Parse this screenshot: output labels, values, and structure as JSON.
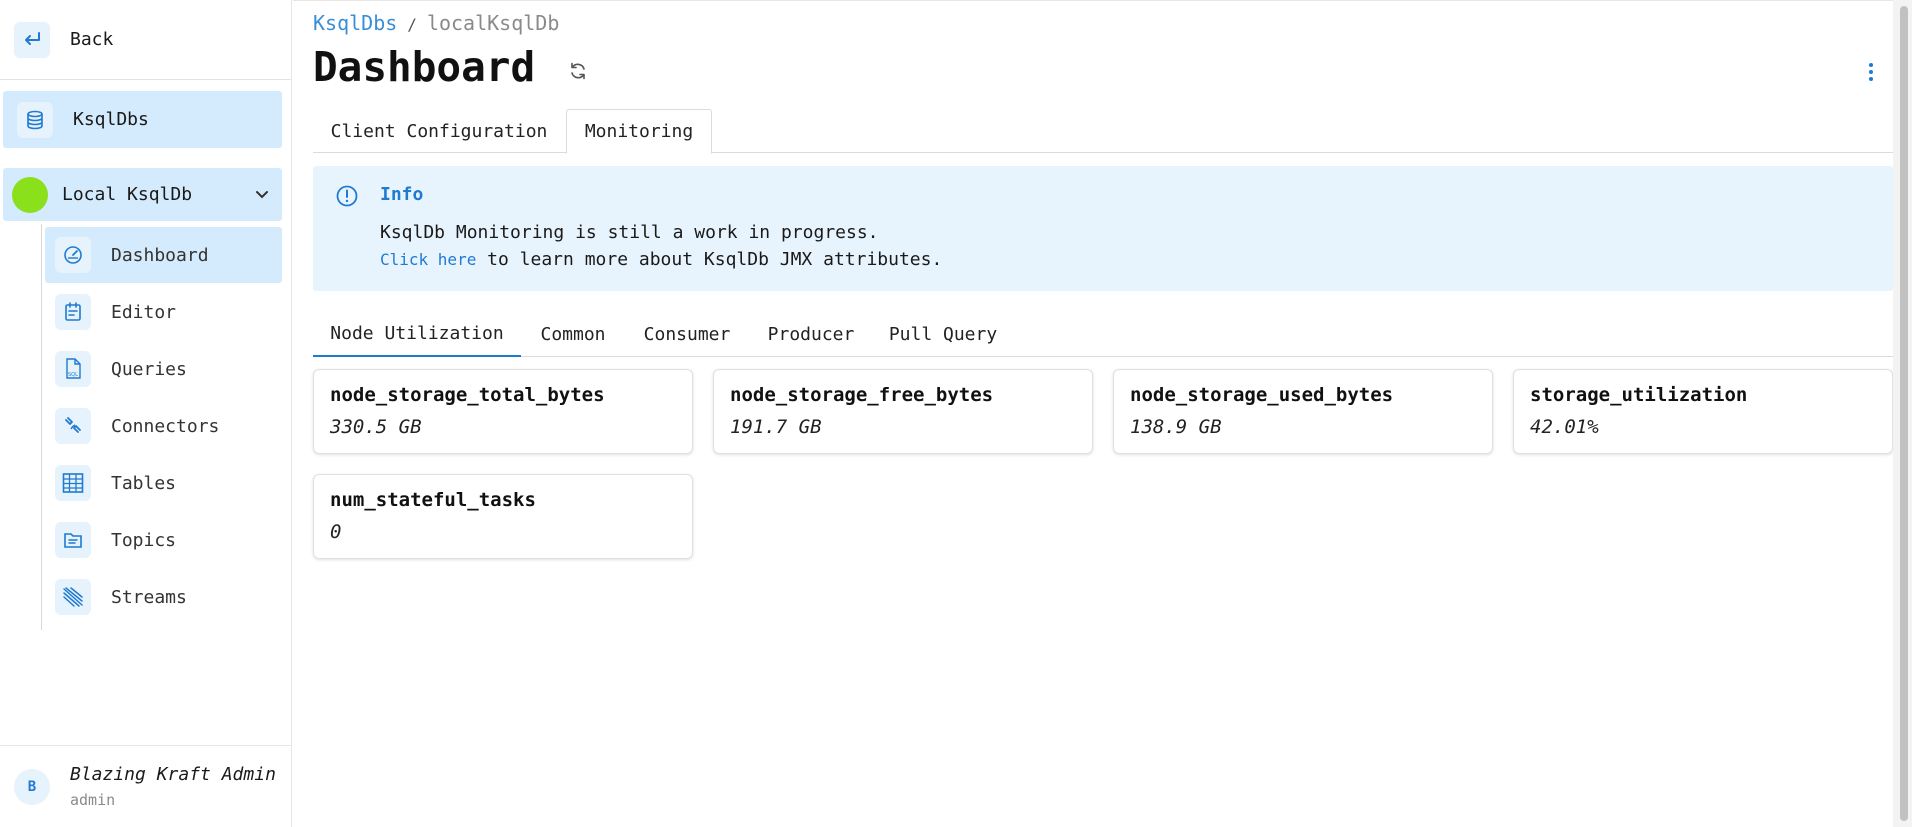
{
  "sidebar": {
    "back_label": "Back",
    "top_item_label": "KsqlDbs",
    "group_label": "Local KsqlDb",
    "group_status_color": "#8ae01a",
    "items": [
      {
        "label": "Dashboard",
        "icon": "speedometer-icon",
        "active": true
      },
      {
        "label": "Editor",
        "icon": "calendar-note-icon"
      },
      {
        "label": "Queries",
        "icon": "sql-file-icon"
      },
      {
        "label": "Connectors",
        "icon": "plug-connector-icon"
      },
      {
        "label": "Tables",
        "icon": "table-grid-icon"
      },
      {
        "label": "Topics",
        "icon": "folder-list-icon"
      },
      {
        "label": "Streams",
        "icon": "streams-icon"
      }
    ],
    "user": {
      "initial": "B",
      "name": "Blazing Kraft Admin",
      "role": "admin"
    }
  },
  "header": {
    "breadcrumb": {
      "link": "KsqlDbs",
      "separator": "/",
      "current": "localKsqlDb"
    },
    "title": "Dashboard"
  },
  "tabs": {
    "client_configuration": "Client Configuration",
    "monitoring": "Monitoring",
    "active": "Monitoring"
  },
  "info": {
    "title": "Info",
    "line1": "KsqlDb Monitoring is still a work in progress.",
    "link_text": "Click here",
    "line2_rest": " to learn more about KsqlDb JMX attributes."
  },
  "subtabs": {
    "node_utilization": "Node Utilization",
    "common": "Common",
    "consumer": "Consumer",
    "producer": "Producer",
    "pull_query": "Pull Query",
    "active": "Node Utilization"
  },
  "metrics": [
    {
      "name": "node_storage_total_bytes",
      "value": "330.5 GB"
    },
    {
      "name": "node_storage_free_bytes",
      "value": "191.7 GB"
    },
    {
      "name": "node_storage_used_bytes",
      "value": "138.9 GB"
    },
    {
      "name": "storage_utilization",
      "value": "42.01%"
    },
    {
      "name": "num_stateful_tasks",
      "value": "0"
    }
  ],
  "colors": {
    "accent": "#1f7ad1",
    "active_bg": "#d3ebfc",
    "info_bg": "#e8f4fd"
  }
}
